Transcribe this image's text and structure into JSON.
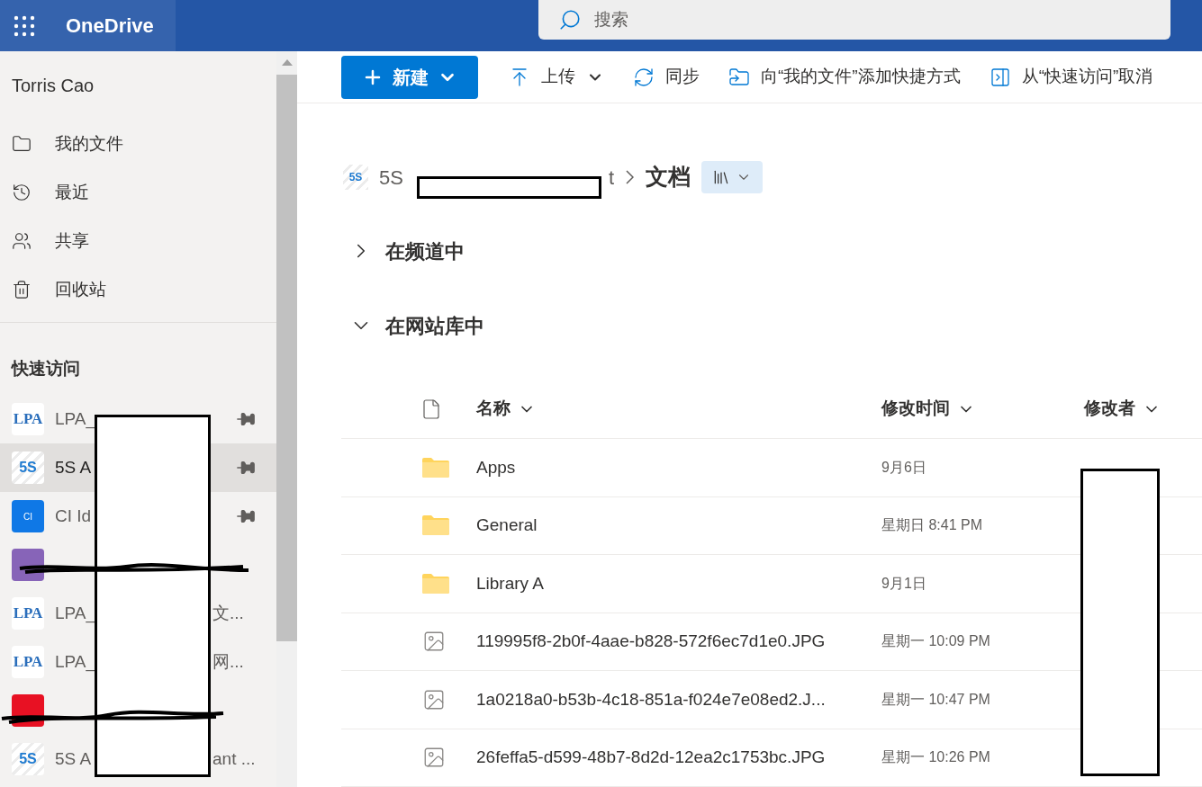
{
  "header": {
    "app_title": "OneDrive",
    "search": {
      "placeholder": "搜索"
    }
  },
  "sidebar": {
    "user": "Torris Cao",
    "nav": [
      {
        "kind": "folder",
        "label": "我的文件"
      },
      {
        "kind": "recent",
        "label": "最近"
      },
      {
        "kind": "shared",
        "label": "共享"
      },
      {
        "kind": "bin",
        "label": "回收站"
      }
    ],
    "quick_access": {
      "title": "快速访问",
      "items": [
        {
          "kind": "lpa",
          "badge": "LPA",
          "label": "LPA_",
          "pinned": true,
          "selected": false
        },
        {
          "kind": "five_s",
          "badge": "5S",
          "label": "5S A",
          "pinned": true,
          "selected": true
        },
        {
          "kind": "ci",
          "badge": "CI",
          "label": "CI Id",
          "pinned": true,
          "selected": false
        },
        {
          "kind": "purple",
          "pinned": false,
          "selected": false
        },
        {
          "kind": "lpa",
          "badge": "LPA",
          "label": "LPA_",
          "label_end": "文...",
          "pinned": false,
          "selected": false
        },
        {
          "kind": "lpa",
          "badge": "LPA",
          "label": "LPA_",
          "label_end": "网...",
          "pinned": false,
          "selected": false
        },
        {
          "kind": "red",
          "pinned": false,
          "selected": false
        },
        {
          "kind": "five_s",
          "badge": "5S",
          "label": "5S A",
          "label_end": "ant ...",
          "pinned": false,
          "selected": false
        }
      ]
    }
  },
  "toolbar": [
    {
      "kind": "new",
      "label": "新建"
    },
    {
      "kind": "upload",
      "label": "上传"
    },
    {
      "kind": "sync",
      "label": "同步"
    },
    {
      "kind": "shortcut",
      "label": "向“我的文件”添加快捷方式"
    },
    {
      "kind": "unpin",
      "label": "从“快速访问”取消"
    }
  ],
  "breadcrumb": {
    "site_badge": "5S",
    "site_start": "5S",
    "site_end": "t",
    "current": "文档"
  },
  "sections": [
    {
      "title": "在频道中",
      "expanded": false
    },
    {
      "title": "在网站库中",
      "expanded": true
    }
  ],
  "table": {
    "columns": [
      "名称",
      "修改时间",
      "修改者"
    ],
    "rows": [
      {
        "kind": "folder",
        "name": "Apps",
        "modified": "9月6日"
      },
      {
        "kind": "folder",
        "name": "General",
        "modified": "星期日 8:41 PM"
      },
      {
        "kind": "folder",
        "name": "Library A",
        "modified": "9月1日"
      },
      {
        "kind": "image",
        "name": "119995f8-2b0f-4aae-b828-572f6ec7d1e0.JPG",
        "modified": "星期一 10:09 PM"
      },
      {
        "kind": "image",
        "name": "1a0218a0-b53b-4c18-851a-f024e7e08ed2.J...",
        "modified": "星期一 10:47 PM"
      },
      {
        "kind": "image",
        "name": "26feffa5-d599-48b7-8d2d-12ea2c1753bc.JPG",
        "modified": "星期一 10:26 PM"
      }
    ]
  }
}
